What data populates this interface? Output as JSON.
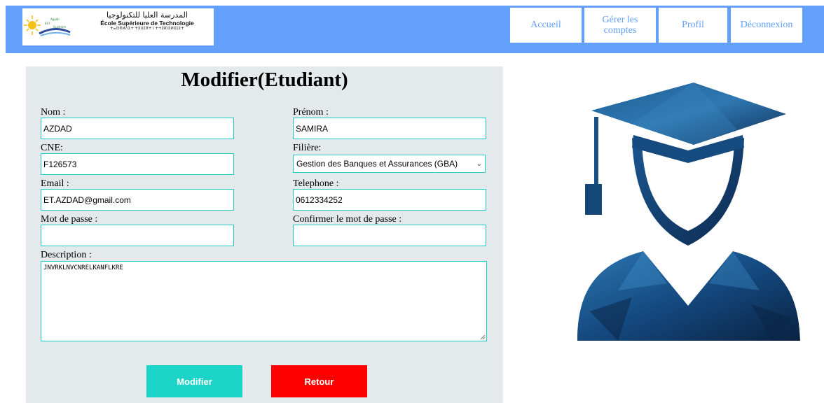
{
  "header": {
    "logo": {
      "arabic": "المدرسة العليا للتكنولوجيا",
      "french": "École Supérieure de Technologie",
      "tifinagh": "ⵜⴰⵙⴳⵍⴷⵉⵜ ⵜⵓⵏⵏⵉⴳⵜ ⵏ ⵜⵜⵉⴽⵏⵓⵍⵓⵊⵉⵜ"
    },
    "nav": {
      "accueil": "Accueil",
      "gerer_line1": "Gérer les",
      "gerer_line2": "comptes",
      "profil": "Profil",
      "deconnexion": "Déconnexion"
    },
    "colors": {
      "navbar": "#62a0fb",
      "nav_text": "#62a0fb"
    }
  },
  "form": {
    "title": "Modifier(Etudiant)",
    "fields": {
      "nom": {
        "label": "Nom :",
        "value": "AZDAD"
      },
      "prenom": {
        "label": "Prénom :",
        "value": "SAMIRA"
      },
      "cne": {
        "label": "CNE:",
        "value": "F126573"
      },
      "filiere": {
        "label": "Filière:",
        "value": "Gestion des Banques et Assurances (GBA)"
      },
      "email": {
        "label": "Email :",
        "value": "ET.AZDAD@gmail.com"
      },
      "telephone": {
        "label": "Telephone :",
        "value": "0612334252"
      },
      "mot_de_passe": {
        "label": "Mot de passe :",
        "value": ""
      },
      "confirmer": {
        "label": "Confirmer le mot de passe :",
        "value": ""
      },
      "description": {
        "label": "Description :",
        "value": "JNVRKLNVCNRELKANFLKRE"
      }
    },
    "buttons": {
      "modifier": "Modifier",
      "retour": "Retour"
    },
    "colors": {
      "panel": "#e4e9eb",
      "field_border": "#1fcfc6",
      "modifier_button": "#1dd4c8",
      "retour_button": "#ff0000"
    }
  },
  "illustration": {
    "icon": "graduate-student-icon"
  }
}
